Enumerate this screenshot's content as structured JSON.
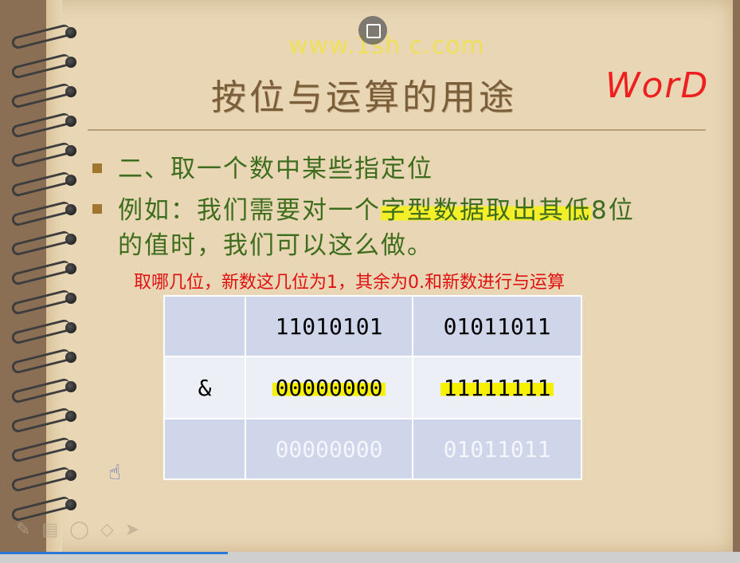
{
  "watermark": "www.1sh c.com",
  "title": "按位与运算的用途",
  "handnote": "WorD",
  "points": [
    {
      "text": "二、取一个数中某些指定位"
    },
    {
      "text_plain": "例如：我们需要对一个",
      "text_highlight": "字型数据取出其低",
      "text_end": "8位",
      "text_line2": "的值时，我们可以这么做。"
    }
  ],
  "note": "取哪几位，新数这几位为1，其余为0.和新数进行与运算",
  "table": {
    "rows": [
      [
        "",
        "11010101",
        "01011011"
      ],
      [
        "&",
        "00000000",
        "11111111"
      ],
      [
        "",
        "00000000",
        "01011011"
      ]
    ]
  },
  "icons": {
    "restore": "restore-window-icon",
    "pointer": "hand-pointer-icon"
  }
}
